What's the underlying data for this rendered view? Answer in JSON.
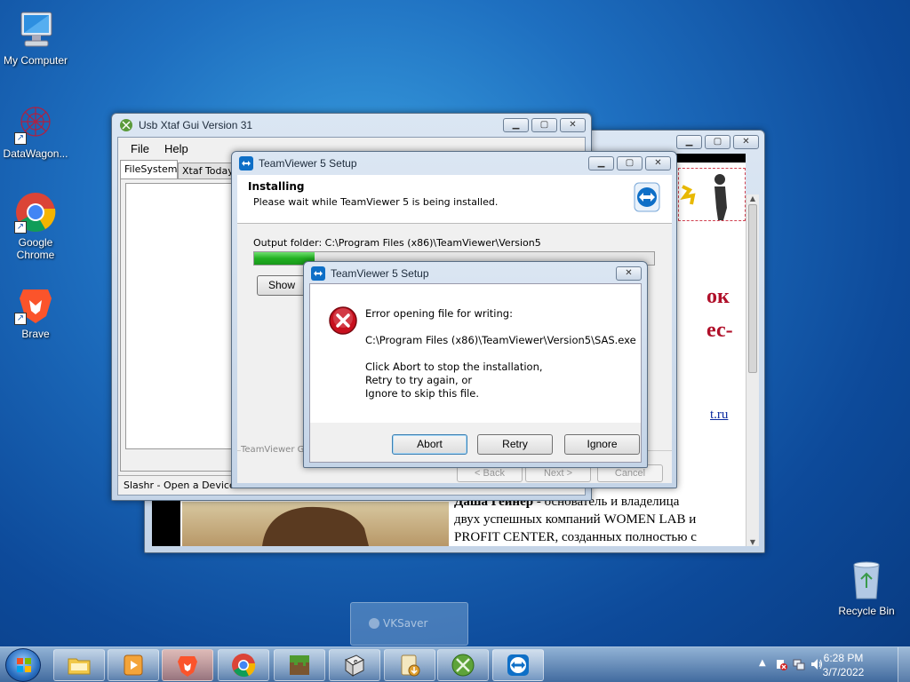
{
  "desktop": {
    "icons": [
      {
        "label": "My Computer",
        "icon": "computer-icon"
      },
      {
        "label": "DataWagon...",
        "icon": "datawagon-icon"
      },
      {
        "label": "Google Chrome",
        "icon": "chrome-icon"
      },
      {
        "label": "Brave",
        "icon": "brave-icon"
      },
      {
        "label": "Recycle Bin",
        "icon": "recycle-bin-icon"
      }
    ]
  },
  "xtaf_window": {
    "title": "Usb Xtaf Gui Version 31",
    "menu": [
      "File",
      "Help"
    ],
    "tabs": [
      "FileSystem",
      "Xtaf Today"
    ],
    "status": "Slashr - Open a Device"
  },
  "browser_window": {
    "fragments": [
      "ок",
      "ес-",
      "t.ru"
    ],
    "paragraph_bold": "Даша Гейнер",
    "paragraph_rest_1": " - основатель и владелица",
    "paragraph_line_2": "двух успешных компаний WOMEN LAB и",
    "paragraph_line_3": "PROFIT CENTER, созданных полностью с"
  },
  "setup_window": {
    "title": "TeamViewer 5 Setup",
    "heading": "Installing",
    "subheading": "Please wait while TeamViewer 5 is being installed.",
    "output_folder": "Output folder: C:\\Program Files (x86)\\TeamViewer\\Version5",
    "progress": 0.15,
    "show_details_label": "Show de",
    "brand_footer": "TeamViewer Gr",
    "back_label": "< Back",
    "next_label": "Next >",
    "cancel_label": "Cancel"
  },
  "error_dialog": {
    "title": "TeamViewer 5 Setup",
    "line1": "Error opening file for writing:",
    "path": "C:\\Program Files (x86)\\TeamViewer\\Version5\\SAS.exe",
    "line3": "Click Abort to stop the installation,",
    "line4": "Retry to try again, or",
    "line5": "Ignore to skip this file.",
    "abort_label": "Abort",
    "retry_label": "Retry",
    "ignore_label": "Ignore"
  },
  "ghost_window": {
    "label": "VKSaver"
  },
  "taskbar": {
    "items": [
      "start-orb",
      "explorer",
      "media-player",
      "brave",
      "chrome",
      "minecraft",
      "ebook",
      "installer",
      "xbox",
      "teamviewer"
    ],
    "time": "6:28 PM",
    "date": "3/7/2022"
  },
  "colors": {
    "accent": "#1e6fc0",
    "progress": "#22b022",
    "error": "#c8101e",
    "teamviewer": "#0e6fc7"
  }
}
